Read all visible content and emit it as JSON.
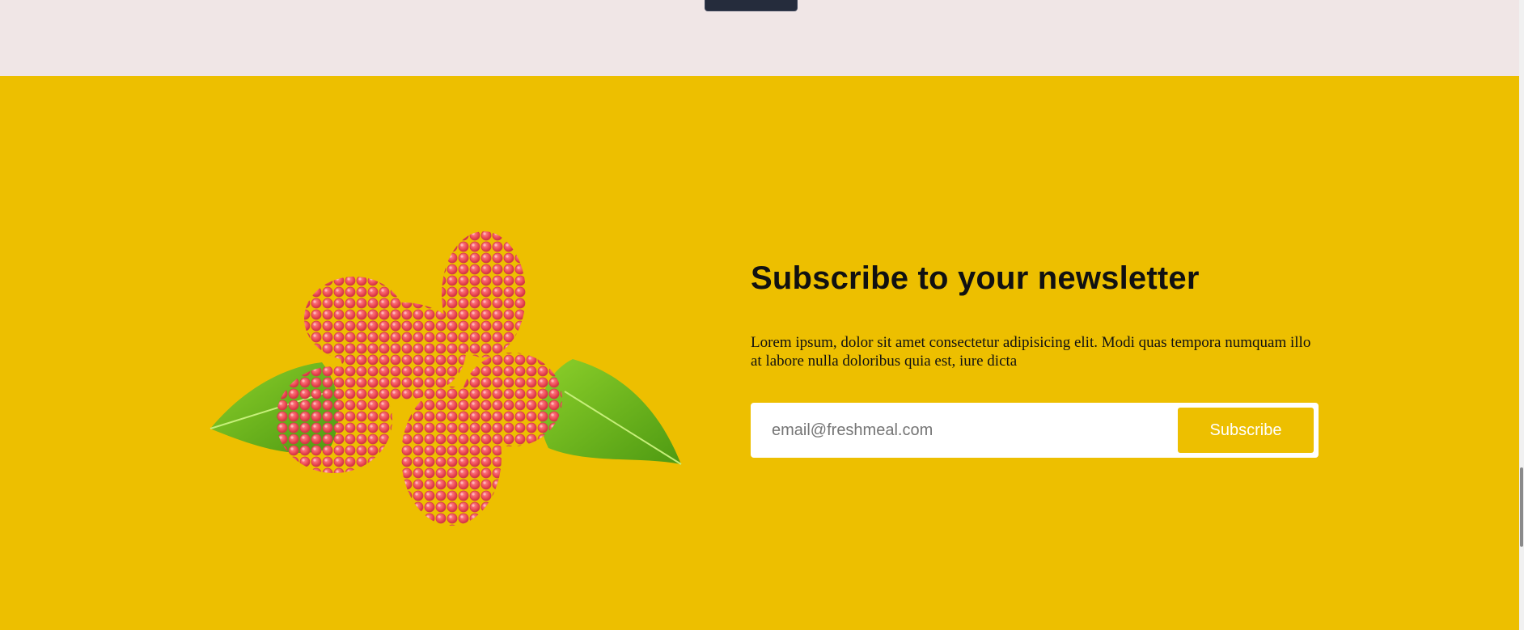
{
  "newsletter": {
    "title": "Subscribe to your newsletter",
    "description": "Lorem ipsum, dolor sit amet consectetur adipisicing elit. Modi quas tempora numquam illo at labore nulla doloribus quia est, iure dicta",
    "email_placeholder": "email@freshmeal.com",
    "subscribe_label": "Subscribe",
    "image": "raspberries-with-leaves"
  },
  "colors": {
    "accent": "#edbf00",
    "top_background": "#f0e6e6",
    "dark_button": "#252c3c"
  }
}
